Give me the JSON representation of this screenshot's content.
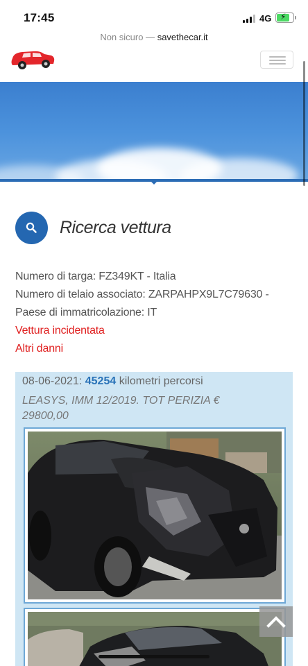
{
  "status_bar": {
    "time": "17:45",
    "network": "4G",
    "battery_level": 0.8,
    "icons": [
      "signal-icon",
      "battery-charging-icon"
    ]
  },
  "url_bar": {
    "security_warning": "Non sicuro —",
    "domain": "savethecar.it"
  },
  "header": {
    "logo_icon": "red-car-logo-icon",
    "menu_icon": "hamburger-menu-icon"
  },
  "search_section": {
    "icon": "search-icon",
    "title": "Ricerca vettura"
  },
  "vehicle": {
    "plate_line": "Numero di targa: FZ349KT - Italia",
    "chassis_line": "Numero di telaio associato: ZARPAHPX9L7C79630 -",
    "country_line": "Paese di immatricolazione: IT",
    "status_damaged": "Vettura incidentata",
    "status_other": "Altri danni"
  },
  "record": {
    "date": "08-06-2021",
    "separator": ":",
    "km": "45254",
    "km_label": "kilometri percorsi",
    "note": "LEASYS, IMM 12/2019. TOT PERIZIA € 29800,00"
  },
  "colors": {
    "brand_blue": "#2467b1",
    "alert_red": "#e02020",
    "record_bg": "#cfe6f4",
    "km_blue": "#2a73b8"
  },
  "back_to_top_icon": "chevron-up-icon"
}
